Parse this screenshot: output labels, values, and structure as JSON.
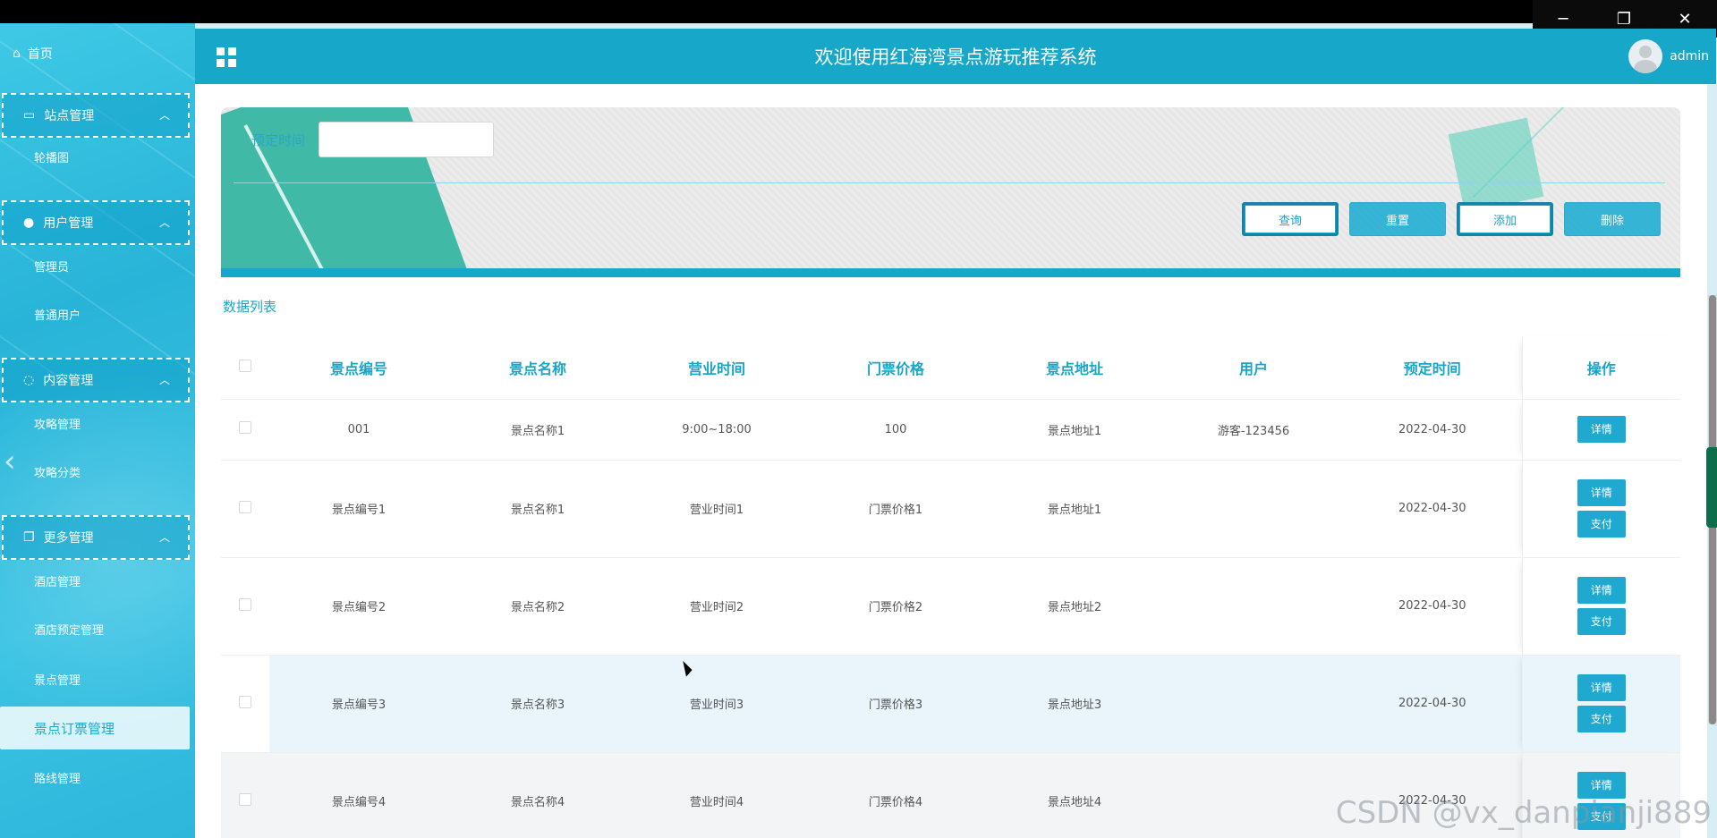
{
  "window": {
    "minimize": "─",
    "restore": "❐",
    "close": "✕"
  },
  "header": {
    "title": "欢迎使用红海湾景点游玩推荐系统",
    "username": "admin"
  },
  "sidebar": {
    "home": "首页",
    "groups": [
      {
        "label": "站点管理",
        "items": [
          "轮播图"
        ]
      },
      {
        "label": "用户管理",
        "items": [
          "管理员",
          "普通用户"
        ]
      },
      {
        "label": "内容管理",
        "items": [
          "攻略管理",
          "攻略分类"
        ]
      },
      {
        "label": "更多管理",
        "items": [
          "酒店管理",
          "酒店预定管理",
          "景点管理",
          "景点订票管理",
          "路线管理",
          " "
        ]
      }
    ],
    "active_item": "景点订票管理"
  },
  "search": {
    "label": "预定时间",
    "value": ""
  },
  "buttons": {
    "query": "查询",
    "reset": "重置",
    "add": "添加",
    "delete": "删除"
  },
  "list_title": "数据列表",
  "table": {
    "columns": [
      "景点编号",
      "景点名称",
      "营业时间",
      "门票价格",
      "景点地址",
      "用户",
      "预定时间",
      "操作"
    ],
    "rows": [
      {
        "code": "001",
        "name": "景点名称1",
        "hours": "9:00~18:00",
        "price": "100",
        "address": "景点地址1",
        "user": "游客-123456",
        "date": "2022-04-30",
        "actions": [
          "详情"
        ]
      },
      {
        "code": "景点编号1",
        "name": "景点名称1",
        "hours": "营业时间1",
        "price": "门票价格1",
        "address": "景点地址1",
        "user": "",
        "date": "2022-04-30",
        "actions": [
          "详情",
          "支付"
        ]
      },
      {
        "code": "景点编号2",
        "name": "景点名称2",
        "hours": "营业时间2",
        "price": "门票价格2",
        "address": "景点地址2",
        "user": "",
        "date": "2022-04-30",
        "actions": [
          "详情",
          "支付"
        ]
      },
      {
        "code": "景点编号3",
        "name": "景点名称3",
        "hours": "营业时间3",
        "price": "门票价格3",
        "address": "景点地址3",
        "user": "",
        "date": "2022-04-30",
        "actions": [
          "详情",
          "支付"
        ]
      },
      {
        "code": "景点编号4",
        "name": "景点名称4",
        "hours": "营业时间4",
        "price": "门票价格4",
        "address": "景点地址4",
        "user": "",
        "date": "2022-04-30",
        "actions": [
          "详情",
          "支付"
        ]
      }
    ]
  },
  "watermark": "CSDN @vx_danpianji889"
}
